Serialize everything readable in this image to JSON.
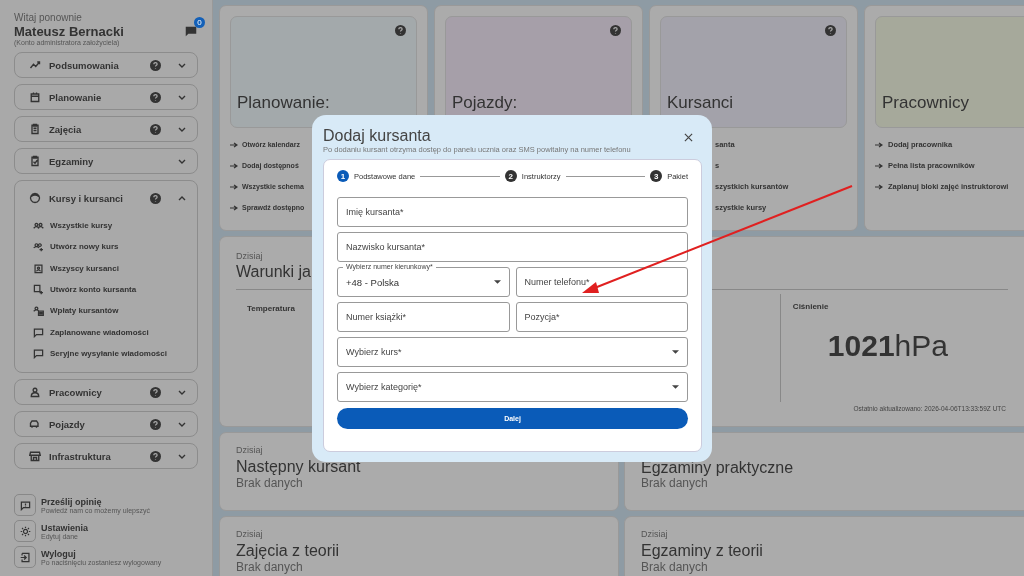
{
  "sidebar": {
    "greeting": "Witaj ponownie",
    "user_name": "Mateusz Bernacki",
    "account_type": "(Konto administratora założyciela)",
    "messages_badge": "0",
    "items": [
      {
        "label": "Podsumowania",
        "help": true,
        "expanded": false
      },
      {
        "label": "Planowanie",
        "help": true,
        "expanded": false
      },
      {
        "label": "Zajęcia",
        "help": true,
        "expanded": false
      },
      {
        "label": "Egzaminy",
        "help": false,
        "expanded": false
      },
      {
        "label": "Kursy i kursanci",
        "help": true,
        "expanded": true,
        "children": [
          {
            "label": "Wszystkie kursy"
          },
          {
            "label": "Utwórz nowy kurs"
          },
          {
            "label": "Wszyscy kursanci"
          },
          {
            "label": "Utwórz konto kursanta"
          },
          {
            "label": "Wpłaty kursantów"
          },
          {
            "label": "Zaplanowane wiadomości"
          },
          {
            "label": "Seryjne wysyłanie wiadomości"
          }
        ]
      },
      {
        "label": "Pracownicy",
        "help": true,
        "expanded": false
      },
      {
        "label": "Pojazdy",
        "help": true,
        "expanded": false
      },
      {
        "label": "Infrastruktura",
        "help": true,
        "expanded": false
      }
    ],
    "footer": [
      {
        "title": "Prześlij opinię",
        "subtitle": "Powiedź nam co możemy ulepszyć"
      },
      {
        "title": "Ustawienia",
        "subtitle": "Edytuj dane"
      },
      {
        "title": "Wyloguj",
        "subtitle": "Po naciśnięciu zostaniesz wylogowany"
      }
    ]
  },
  "section_cards": [
    {
      "title": "Planowanie:",
      "help": true,
      "links": [
        "Otwórz kalendarz",
        "Dodaj dostępnoś",
        "Wszystkie schema",
        "Sprawdź dostępno"
      ]
    },
    {
      "title": "Pojazdy:",
      "help": true
    },
    {
      "title": "Kursanci",
      "help": true,
      "links": [
        "santa",
        "s",
        "szystkich kursantów",
        "szystkie kursy"
      ]
    },
    {
      "title": "Pracownicy",
      "help": false,
      "links": [
        "Dodaj pracownika",
        "Pełna lista pracowników",
        "Zaplanuj bloki zajęć instruktorowi"
      ]
    }
  ],
  "weather": {
    "caption": "Dzisiaj",
    "title": "Warunki ja",
    "temperature_label": "Temperatura",
    "pressure_label": "Ciśnienie",
    "pressure_value": "1021",
    "pressure_unit": "hPa",
    "updated": "Ostatnio aktualizowano: 2026-04-06T13:33:59Z UTC"
  },
  "today_cards": [
    {
      "caption": "Dzisiaj",
      "title": "Następny kursant",
      "value": "Brak danych"
    },
    {
      "title": "Egzaminy praktyczne",
      "value": "Brak danych"
    },
    {
      "caption": "Dzisiaj",
      "title": "Zajęcia z teorii",
      "value": "Brak danych"
    },
    {
      "caption": "Dzisiaj",
      "title": "Egzaminy z teorii",
      "value": "Brak danych"
    }
  ],
  "dialog": {
    "title": "Dodaj kursanta",
    "subtitle": "Po dodaniu kursant otrzyma dostęp do panelu ucznia oraz SMS powitalny na numer telefonu",
    "steps": [
      {
        "number": "1",
        "label": "Podstawowe dane",
        "selected": true
      },
      {
        "number": "2",
        "label": "Instruktorzy",
        "selected": false
      },
      {
        "number": "3",
        "label": "Pakiet",
        "selected": false
      }
    ],
    "rows": [
      [
        {
          "kind": "text",
          "placeholder": "Imię kursanta*"
        }
      ],
      [
        {
          "kind": "text",
          "placeholder": "Nazwisko kursanta*"
        }
      ],
      [
        {
          "kind": "select",
          "label": "Wybierz numer kierunkowy*",
          "value": "+48 - Polska"
        },
        {
          "kind": "text",
          "placeholder": "Numer telefonu*"
        }
      ],
      [
        {
          "kind": "text",
          "placeholder": "Numer książki*"
        },
        {
          "kind": "text",
          "placeholder": "Pozycja*"
        }
      ],
      [
        {
          "kind": "select",
          "placeholder": "Wybierz kurs*"
        }
      ],
      [
        {
          "kind": "select",
          "placeholder": "Wybierz kategorię*"
        }
      ]
    ],
    "submit": "Dalej"
  }
}
